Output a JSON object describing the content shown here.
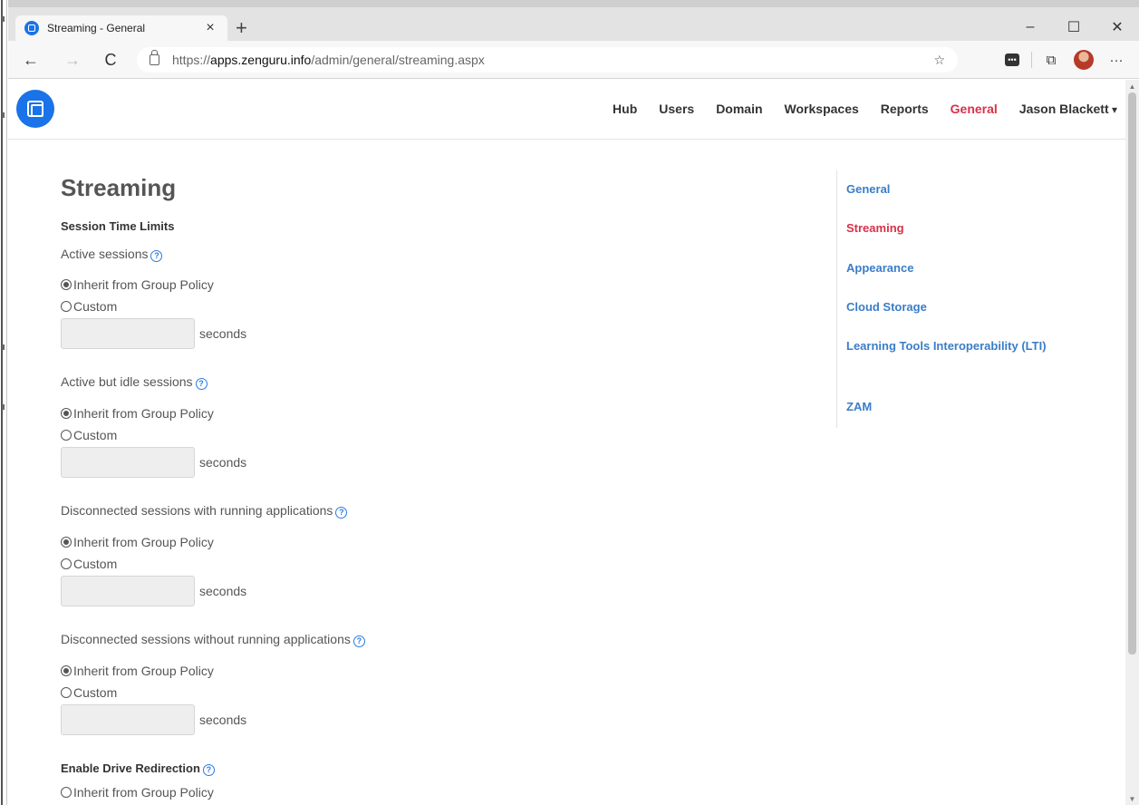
{
  "browser": {
    "tab_title": "Streaming - General",
    "tab_close": "×",
    "new_tab": "+",
    "win_minimize": "–",
    "win_maximize": "☐",
    "win_close": "✕",
    "back": "←",
    "forward": "→",
    "reload": "C",
    "url_scheme": "https://",
    "url_host": "apps.zenguru.info",
    "url_path": "/admin/general/streaming.aspx",
    "favorite": "☆",
    "collections": "⧉",
    "extension": "•••",
    "more": "···"
  },
  "app": {
    "nav": {
      "hub": "Hub",
      "users": "Users",
      "domain": "Domain",
      "workspaces": "Workspaces",
      "reports": "Reports",
      "general": "General",
      "user": "Jason Blackett"
    }
  },
  "page": {
    "title": "Streaming",
    "session_time_limits": "Session Time Limits",
    "help": "?",
    "seconds_label": "seconds",
    "inherit_label": "Inherit from Group Policy",
    "custom_label": "Custom",
    "fields": [
      {
        "label": "Active sessions"
      },
      {
        "label": "Active but idle sessions"
      },
      {
        "label": "Disconnected sessions with running applications"
      },
      {
        "label": "Disconnected sessions without running applications"
      }
    ],
    "drive_redirection": {
      "label": "Enable Drive Redirection",
      "inherit_label": "Inherit from Group Policy"
    }
  },
  "side_nav": {
    "items": [
      "General",
      "Streaming",
      "Appearance",
      "Cloud Storage",
      "Learning Tools Interoperability (LTI)",
      "ZAM"
    ]
  },
  "colors": {
    "accent": "#d9304a",
    "link": "#3a7dc8",
    "brand": "#1a73e8"
  }
}
